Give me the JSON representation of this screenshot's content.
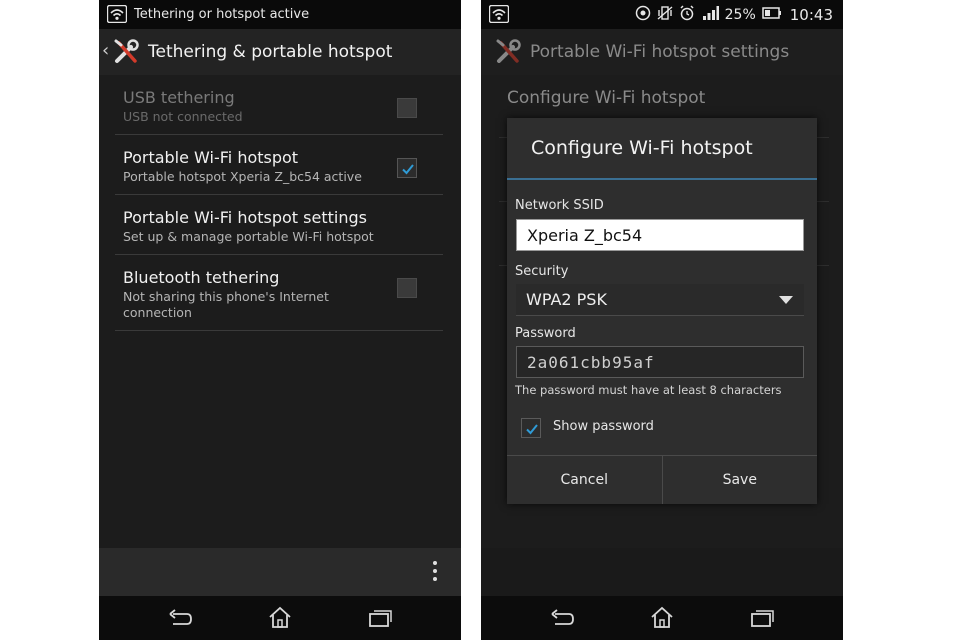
{
  "left_screen": {
    "status": {
      "notification": "Tethering or hotspot active",
      "wifi_icon": "hotspot-icon"
    },
    "action_bar": {
      "title": "Tethering & portable hotspot",
      "back_icon": "chevron-left-icon",
      "app_icon": "tools-icon"
    },
    "settings": [
      {
        "title": "USB tethering",
        "summary": "USB not connected",
        "checked": false,
        "enabled": false
      },
      {
        "title": "Portable Wi-Fi hotspot",
        "summary": "Portable hotspot Xperia Z_bc54 active",
        "checked": true,
        "enabled": true
      },
      {
        "title": "Portable Wi-Fi hotspot settings",
        "summary": "Set up & manage portable Wi-Fi hotspot",
        "enabled": true
      },
      {
        "title": "Bluetooth tethering",
        "summary": "Not sharing this phone's Internet connection",
        "checked": false,
        "enabled": true
      }
    ],
    "overflow_icon": "overflow-menu-icon"
  },
  "right_screen": {
    "status": {
      "battery": "25%",
      "time": "10:43"
    },
    "action_bar": {
      "title": "Portable Wi-Fi hotspot settings",
      "app_icon": "tools-icon"
    },
    "background": {
      "item_title": "Configure Wi-Fi hotspot"
    },
    "dialog": {
      "title": "Configure Wi-Fi hotspot",
      "ssid_label": "Network SSID",
      "ssid_value": "Xperia Z_bc54",
      "security_label": "Security",
      "security_value": "WPA2 PSK",
      "password_label": "Password",
      "password_value": "2a061cbb95af",
      "password_hint": "The password must have at least 8 characters",
      "show_password_label": "Show password",
      "show_password_checked": true,
      "cancel_label": "Cancel",
      "save_label": "Save"
    }
  },
  "colors": {
    "background": "#1c1c1c",
    "accent_divider": "#3a6f93",
    "check": "#2f9bd6"
  }
}
